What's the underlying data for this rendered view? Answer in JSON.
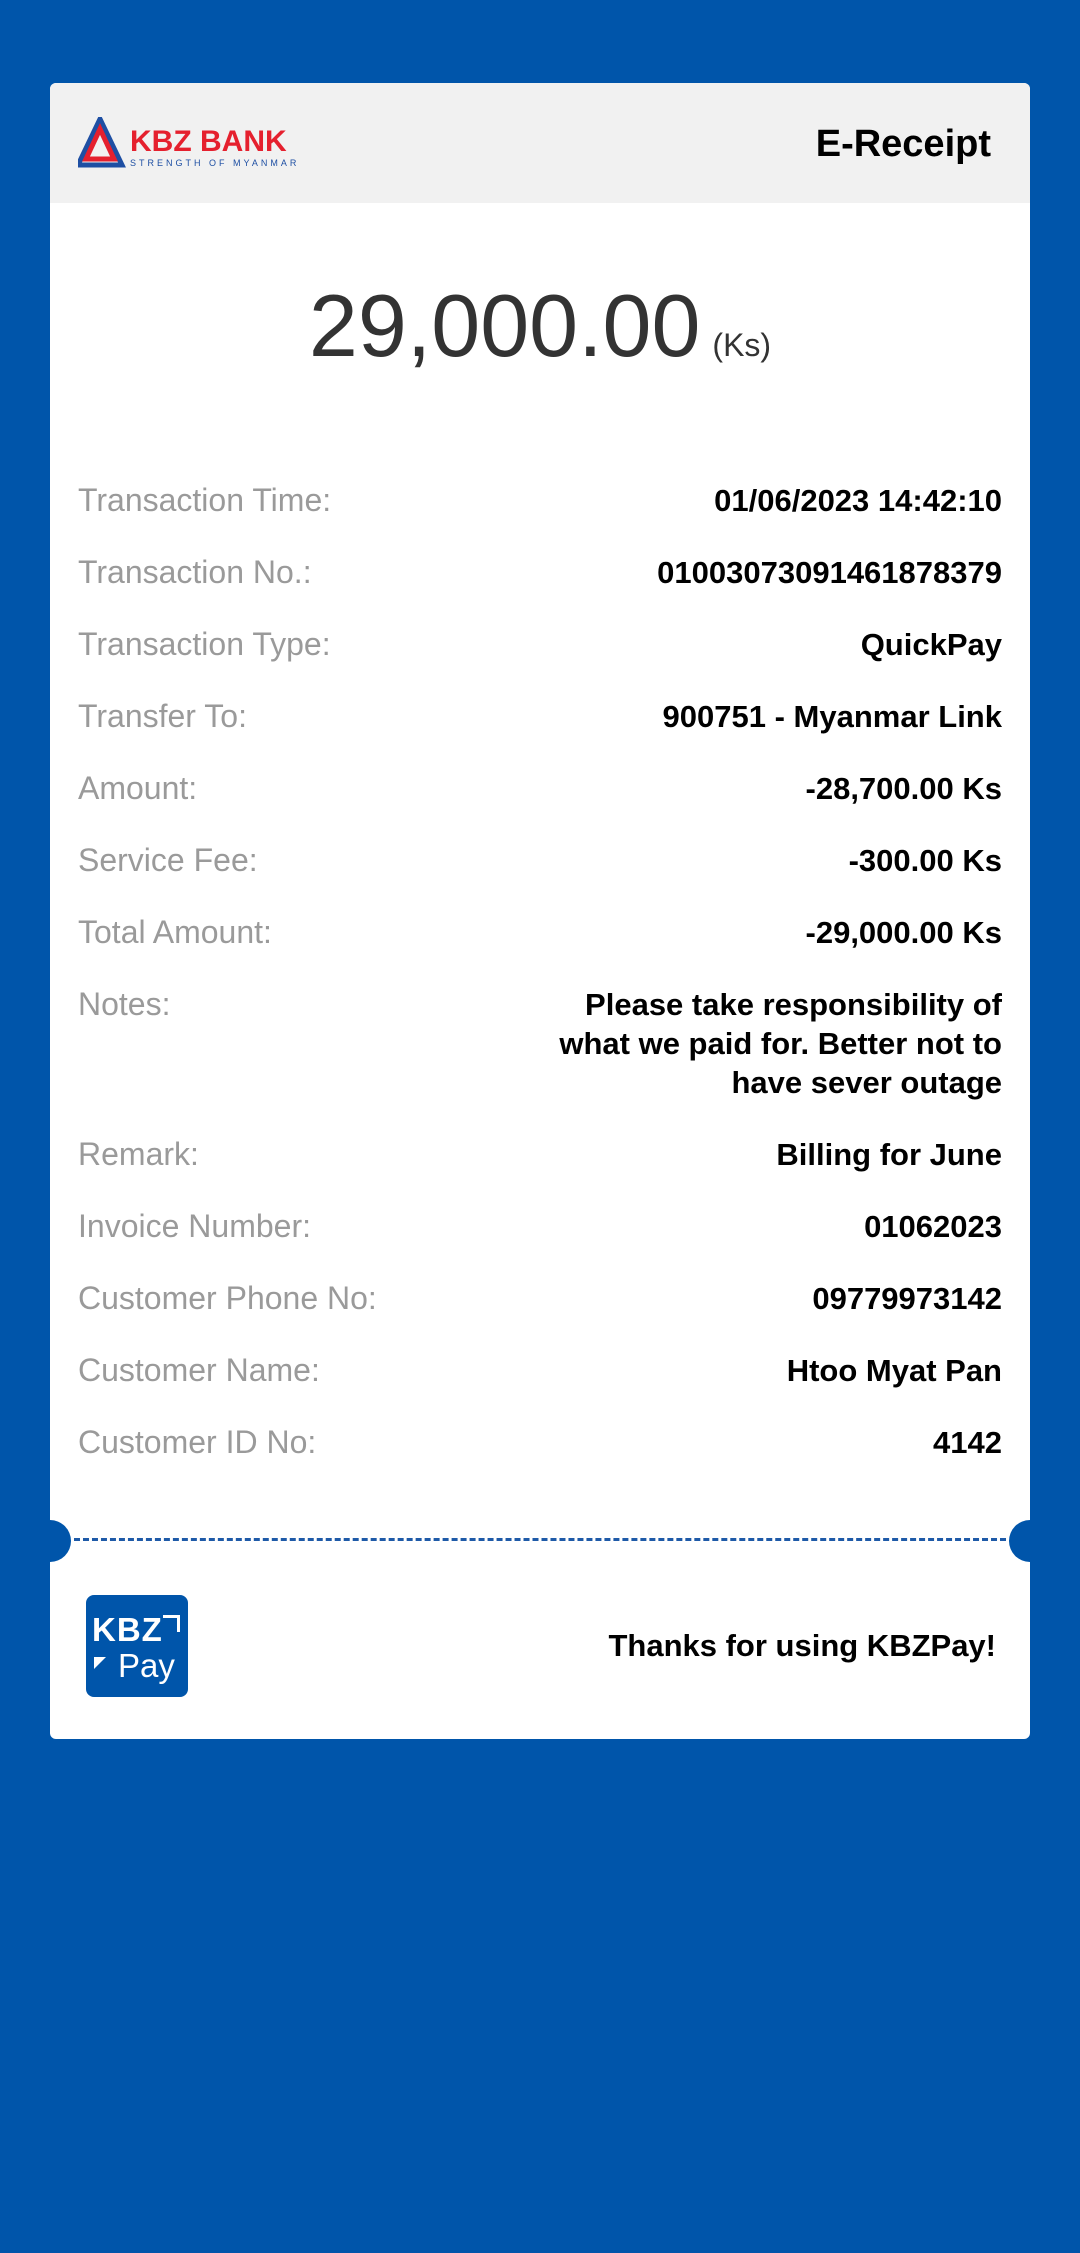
{
  "header": {
    "brand_name": "KBZ BANK",
    "brand_tagline": "STRENGTH OF MYANMAR",
    "title": "E-Receipt"
  },
  "amount": {
    "value": "29,000.00",
    "unit": "(Ks)"
  },
  "details": [
    {
      "label": "Transaction Time:",
      "value": "01/06/2023 14:42:10"
    },
    {
      "label": "Transaction No.:",
      "value": "01003073091461878379"
    },
    {
      "label": "Transaction Type:",
      "value": "QuickPay"
    },
    {
      "label": "Transfer To:",
      "value": "900751 - Myanmar Link"
    },
    {
      "label": "Amount:",
      "value": "-28,700.00 Ks"
    },
    {
      "label": "Service Fee:",
      "value": "-300.00 Ks"
    },
    {
      "label": "Total Amount:",
      "value": "-29,000.00 Ks"
    },
    {
      "label": "Notes:",
      "value": "Please take responsibility of what we paid for. Better not to have sever outage"
    },
    {
      "label": "Remark:",
      "value": "Billing for June"
    },
    {
      "label": "Invoice Number:",
      "value": "01062023"
    },
    {
      "label": "Customer Phone No:",
      "value": "09779973142"
    },
    {
      "label": "Customer Name:",
      "value": "Htoo Myat Pan"
    },
    {
      "label": "Customer ID No:",
      "value": "4142"
    }
  ],
  "footer": {
    "app_logo_text_top": "KBZ",
    "app_logo_text_bottom": "Pay",
    "thanks_text": "Thanks for using KBZPay!"
  },
  "colors": {
    "background": "#0055aa",
    "brand_red": "#e5202e",
    "brand_blue": "#1e4fa3"
  }
}
